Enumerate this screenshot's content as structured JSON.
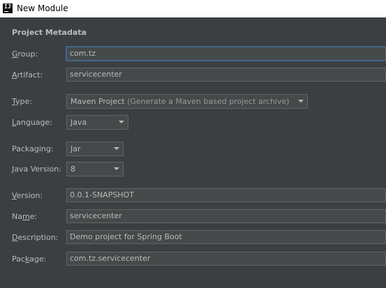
{
  "window": {
    "title": "New Module",
    "icon_glyph": "IJ"
  },
  "section_title": "Project Metadata",
  "fields": {
    "group": {
      "label_prefix": "",
      "mnemonic": "G",
      "label_rest": "roup:",
      "value": "com.tz"
    },
    "artifact": {
      "label_prefix": "",
      "mnemonic": "A",
      "label_rest": "rtifact:",
      "value": "servicecenter"
    },
    "type": {
      "label_prefix": "",
      "mnemonic": "T",
      "label_rest": "ype:",
      "value": "Maven Project",
      "hint": " (Generate a Maven based project archive)"
    },
    "language": {
      "label_prefix": "",
      "mnemonic": "L",
      "label_rest": "anguage:",
      "value": "Java"
    },
    "packaging": {
      "label_prefix": "Packa",
      "mnemonic": "g",
      "label_rest": "ing:",
      "value": "Jar"
    },
    "java_version": {
      "label_prefix": "",
      "mnemonic": "J",
      "label_rest": "ava Version:",
      "value": "8"
    },
    "version": {
      "label_prefix": "",
      "mnemonic": "V",
      "label_rest": "ersion:",
      "value": "0.0.1-SNAPSHOT"
    },
    "name": {
      "label_prefix": "Na",
      "mnemonic": "m",
      "label_rest": "e:",
      "value": "servicecenter"
    },
    "description": {
      "label_prefix": "",
      "mnemonic": "D",
      "label_rest": "escription:",
      "value": "Demo project for Spring Boot"
    },
    "package": {
      "label_prefix": "Pac",
      "mnemonic": "k",
      "label_rest": "age:",
      "value": "com.tz.servicecenter"
    }
  },
  "icons": {
    "dropdown": "chevron-down-icon",
    "app": "intellij-idea-icon"
  },
  "colors": {
    "background": "#3c3f41",
    "field_bg": "#45494a",
    "focus_border": "#466d94",
    "text": "#bbbbbb"
  }
}
